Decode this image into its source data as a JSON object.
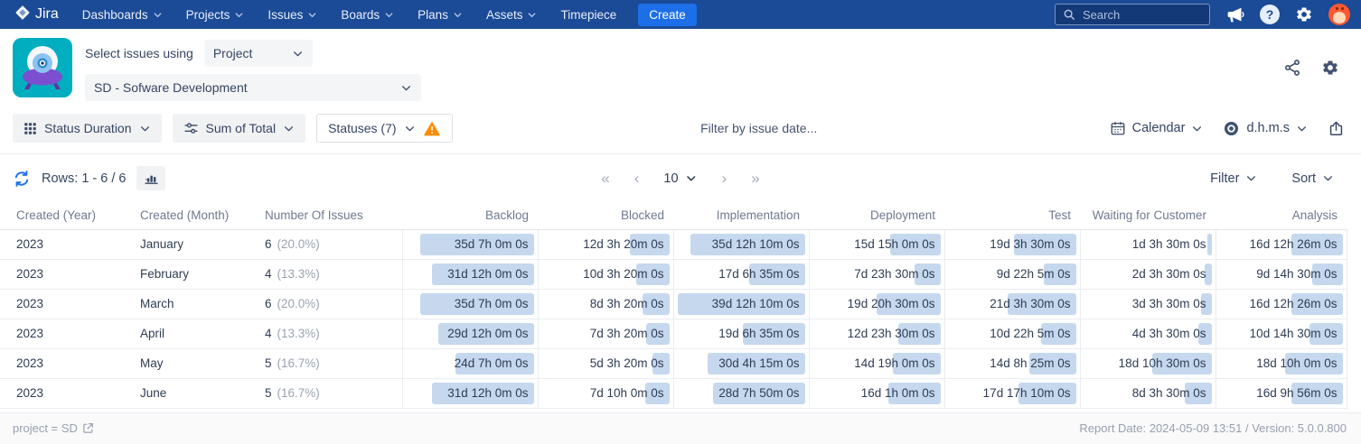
{
  "navbar": {
    "brand": "Jira",
    "items": [
      "Dashboards",
      "Projects",
      "Issues",
      "Boards",
      "Plans",
      "Assets",
      "Timepiece"
    ],
    "create_label": "Create",
    "search_placeholder": "Search"
  },
  "header": {
    "select_label": "Select issues using",
    "select_value": "Project",
    "project_value": "SD - Sofware Development"
  },
  "toolbar": {
    "report_type": "Status Duration",
    "aggregation": "Sum of Total",
    "statuses_label": "Statuses (7)",
    "date_filter_placeholder": "Filter by issue date...",
    "calendar_label": "Calendar",
    "time_format_label": "d.h.m.s"
  },
  "controls": {
    "rows_label": "Rows: 1 - 6 / 6",
    "page_size": "10",
    "pagination": {
      "first": "«",
      "prev": "‹",
      "next": "›",
      "last": "»"
    },
    "filter_label": "Filter",
    "sort_label": "Sort"
  },
  "table": {
    "columns": [
      "Created (Year)",
      "Created (Month)",
      "Number Of Issues",
      "Backlog",
      "Blocked",
      "Implementation",
      "Deployment",
      "Test",
      "Waiting for Customer",
      "Analysis"
    ],
    "rows": [
      {
        "year": "2023",
        "month": "January",
        "issues": "6",
        "percent": "(20.0%)",
        "durations": [
          {
            "text": "35d 7h 0m 0s",
            "pct": 89.3
          },
          {
            "text": "12d 3h 20m 0s",
            "pct": 30.7
          },
          {
            "text": "35d 12h 10m 0s",
            "pct": 89.9
          },
          {
            "text": "15d 15h 0m 0s",
            "pct": 39.6
          },
          {
            "text": "19d 3h 30m 0s",
            "pct": 48.5
          },
          {
            "text": "1d 3h 30m 0s",
            "pct": 2.9
          },
          {
            "text": "16d 12h 26m 0s",
            "pct": 41.8
          }
        ]
      },
      {
        "year": "2023",
        "month": "February",
        "issues": "4",
        "percent": "(13.3%)",
        "durations": [
          {
            "text": "31d 12h 0m 0s",
            "pct": 79.7
          },
          {
            "text": "10d 3h 20m 0s",
            "pct": 25.7
          },
          {
            "text": "17d 6h 35m 0s",
            "pct": 43.7
          },
          {
            "text": "7d 23h 30m 0s",
            "pct": 20.2
          },
          {
            "text": "9d 22h 5m 0s",
            "pct": 25.1
          },
          {
            "text": "2d 3h 30m 0s",
            "pct": 5.4
          },
          {
            "text": "9d 14h 30m 0s",
            "pct": 24.3
          }
        ]
      },
      {
        "year": "2023",
        "month": "March",
        "issues": "6",
        "percent": "(20.0%)",
        "durations": [
          {
            "text": "35d 7h 0m 0s",
            "pct": 89.3
          },
          {
            "text": "8d 3h 20m 0s",
            "pct": 20.6
          },
          {
            "text": "39d 12h 10m 0s",
            "pct": 100
          },
          {
            "text": "19d 20h 30m 0s",
            "pct": 50.3
          },
          {
            "text": "21d 3h 30m 0s",
            "pct": 53.5
          },
          {
            "text": "3d 3h 30m 0s",
            "pct": 8.0
          },
          {
            "text": "16d 12h 26m 0s",
            "pct": 41.8
          }
        ]
      },
      {
        "year": "2023",
        "month": "April",
        "issues": "4",
        "percent": "(13.3%)",
        "durations": [
          {
            "text": "29d 12h 0m 0s",
            "pct": 74.7
          },
          {
            "text": "7d 3h 20m 0s",
            "pct": 18.1
          },
          {
            "text": "19d 6h 35m 0s",
            "pct": 48.8
          },
          {
            "text": "12d 23h 30m 0s",
            "pct": 32.9
          },
          {
            "text": "10d 22h 5m 0s",
            "pct": 27.6
          },
          {
            "text": "4d 3h 30m 0s",
            "pct": 10.5
          },
          {
            "text": "10d 14h 30m 0s",
            "pct": 26.8
          }
        ]
      },
      {
        "year": "2023",
        "month": "May",
        "issues": "5",
        "percent": "(16.7%)",
        "durations": [
          {
            "text": "24d 7h 0m 0s",
            "pct": 61.5
          },
          {
            "text": "5d 3h 20m 0s",
            "pct": 13.0
          },
          {
            "text": "30d 4h 15m 0s",
            "pct": 76.4
          },
          {
            "text": "14d 19h 0m 0s",
            "pct": 37.4
          },
          {
            "text": "14d 8h 25m 0s",
            "pct": 36.3
          },
          {
            "text": "18d 10h 30m 0s",
            "pct": 46.7
          },
          {
            "text": "18d 10h 0m 0s",
            "pct": 46.6
          }
        ]
      },
      {
        "year": "2023",
        "month": "June",
        "issues": "5",
        "percent": "(16.7%)",
        "durations": [
          {
            "text": "31d 12h 0m 0s",
            "pct": 79.7
          },
          {
            "text": "7d 10h 0m 0s",
            "pct": 18.8
          },
          {
            "text": "28d 7h 50m 0s",
            "pct": 71.7
          },
          {
            "text": "16d 1h 0m 0s",
            "pct": 40.6
          },
          {
            "text": "17d 17h 10m 0s",
            "pct": 44.8
          },
          {
            "text": "8d 3h 30m 0s",
            "pct": 20.6
          },
          {
            "text": "16d 9h 56m 0s",
            "pct": 41.5
          }
        ]
      }
    ]
  },
  "footer": {
    "query": "project = SD",
    "report_info": "Report Date: 2024-05-09 13:51 / Version: 5.0.0.800"
  },
  "colors": {
    "navbar_bg": "#1B4A96",
    "accent_blue": "#1D6FE8",
    "duration_bar": "#C5D8EE",
    "warning": "#FF8B00",
    "app_icon_teal": "#00AEC0"
  }
}
